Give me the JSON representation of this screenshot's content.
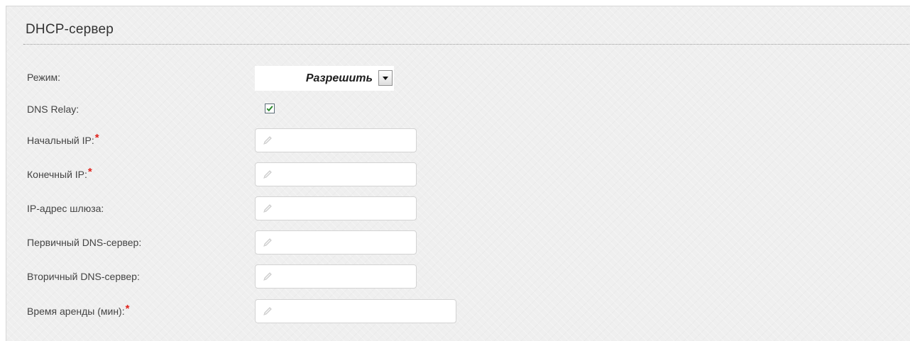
{
  "section": {
    "title": "DHCP-сервер"
  },
  "form": {
    "mode": {
      "label": "Режим:",
      "value": "Разрешить"
    },
    "dns_relay": {
      "label": "DNS Relay:",
      "checked": true
    },
    "start_ip": {
      "label": "Начальный IP:",
      "required_mark": "*",
      "value": ""
    },
    "end_ip": {
      "label": "Конечный IP:",
      "required_mark": "*",
      "value": ""
    },
    "gateway": {
      "label": "IP-адрес шлюза:",
      "value": ""
    },
    "primary_dns": {
      "label": "Первичный DNS-сервер:",
      "value": ""
    },
    "secondary_dns": {
      "label": "Вторичный DNS-сервер:",
      "value": ""
    },
    "lease_time": {
      "label": "Время аренды (мин):",
      "required_mark": "*",
      "value": ""
    }
  },
  "icons": {
    "dropdown": "chevron-down-icon",
    "checkbox": "checkmark-icon",
    "input": "pencil-icon"
  },
  "colors": {
    "panel_background": "#efefef",
    "required_mark": "#e0211b",
    "checkmark": "#2d8a2f",
    "label_text": "#444444"
  }
}
